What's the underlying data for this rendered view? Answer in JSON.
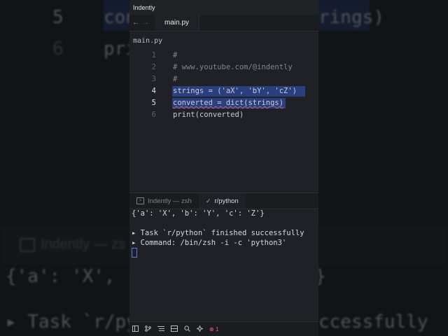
{
  "window": {
    "title": "Indently"
  },
  "tabbar": {
    "back_glyph": "←",
    "forward_glyph": "→",
    "active_tab": "main.py"
  },
  "breadcrumb": {
    "file": "main.py"
  },
  "editor": {
    "lines": [
      {
        "num": "1",
        "text": "#"
      },
      {
        "num": "2",
        "text": "# www.youtube.com/@indently"
      },
      {
        "num": "3",
        "text": "#"
      },
      {
        "num": "4",
        "text": "strings = ('aX', 'bY', 'cZ')"
      },
      {
        "num": "5",
        "text": "converted = dict(strings)"
      },
      {
        "num": "6",
        "text": "print(converted)"
      }
    ]
  },
  "panel": {
    "tabs": [
      {
        "label": "Indently — zsh"
      },
      {
        "label": "r/python"
      }
    ],
    "output": [
      "{'a': 'X', 'b': 'Y', 'c': 'Z'}",
      "▸ Task `r/python` finished successfully",
      "▸ Command: /bin/zsh -i -c 'python3'"
    ]
  },
  "statusbar": {
    "error_count": "1"
  },
  "background": {
    "line5_num": "5",
    "line6_num": "6",
    "line5_start": "conv",
    "line5_end": "rings)",
    "line6_start": "prin",
    "term_tab": "Indently — zs",
    "out_start": "{'a': 'X', '",
    "out_end": "}",
    "task_start": "▸ Task `r/py",
    "task_end": "ccessfully"
  },
  "colors": {
    "selection": "#2b3f7e",
    "background": "#1f2126",
    "accent": "#5a7bd8"
  }
}
